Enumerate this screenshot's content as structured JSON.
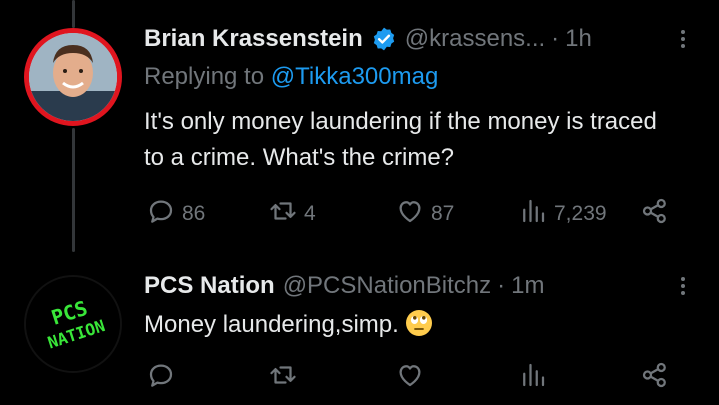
{
  "thread": [
    {
      "author_name": "Brian Krassenstein",
      "verified": true,
      "handle": "@krassens...",
      "separator": "·",
      "time": "1h",
      "replying_prefix": "Replying to",
      "replying_to": "@Tikka300mag",
      "text": "It's only money laundering if the money is traced to a crime.  What's the crime?",
      "stats": {
        "replies": "86",
        "retweets": "4",
        "likes": "87",
        "views": "7,239"
      }
    },
    {
      "author_name": "PCS Nation",
      "handle": "@PCSNationBitchz",
      "separator": "·",
      "time": "1m",
      "text": "Money laundering,simp.",
      "emoji": "face-with-rolling-eyes",
      "avatar_text": "PCS NATION",
      "stats": {
        "replies": "",
        "retweets": "",
        "likes": "",
        "views": ""
      }
    }
  ],
  "icons": {
    "verified": "verified-badge-icon",
    "more": "more-options-icon",
    "reply": "reply-icon",
    "retweet": "retweet-icon",
    "like": "heart-icon",
    "views": "views-icon",
    "share": "share-icon"
  },
  "colors": {
    "background": "#000000",
    "text": "#e7e9ea",
    "muted": "#71767b",
    "accent": "#1d9bf0",
    "avatar_ring": "#e0151f",
    "pcs_green": "#39e639"
  }
}
